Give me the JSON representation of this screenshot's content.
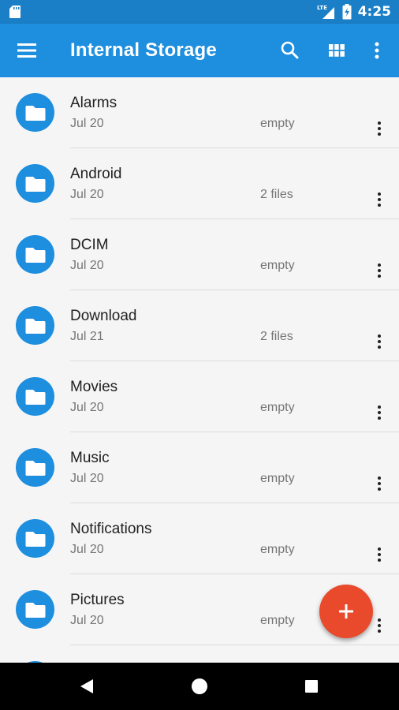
{
  "status_bar": {
    "time": "4:25",
    "network_label": "LTE",
    "icons": [
      "sd-card-icon",
      "lte-signal-icon",
      "battery-charging-icon"
    ]
  },
  "app_bar": {
    "title": "Internal Storage",
    "icons": [
      "menu-icon",
      "search-icon",
      "grid-view-icon",
      "more-vert-icon"
    ]
  },
  "files": [
    {
      "name": "Alarms",
      "date": "Jul 20",
      "size": "empty"
    },
    {
      "name": "Android",
      "date": "Jul 20",
      "size": "2 files"
    },
    {
      "name": "DCIM",
      "date": "Jul 20",
      "size": "empty"
    },
    {
      "name": "Download",
      "date": "Jul 21",
      "size": "2 files"
    },
    {
      "name": "Movies",
      "date": "Jul 20",
      "size": "empty"
    },
    {
      "name": "Music",
      "date": "Jul 20",
      "size": "empty"
    },
    {
      "name": "Notifications",
      "date": "Jul 20",
      "size": "empty"
    },
    {
      "name": "Pictures",
      "date": "Jul 20",
      "size": "empty"
    },
    {
      "name": "",
      "date": "",
      "size": ""
    }
  ],
  "fab": {
    "icon": "add-icon"
  },
  "nav_bar": {
    "icons": [
      "back-icon",
      "home-icon",
      "recents-icon"
    ]
  },
  "colors": {
    "status_bar": "#1b7fc7",
    "app_bar": "#1e8ede",
    "folder_circle": "#1e8ede",
    "fab": "#e94a2b",
    "background": "#f5f5f5"
  }
}
